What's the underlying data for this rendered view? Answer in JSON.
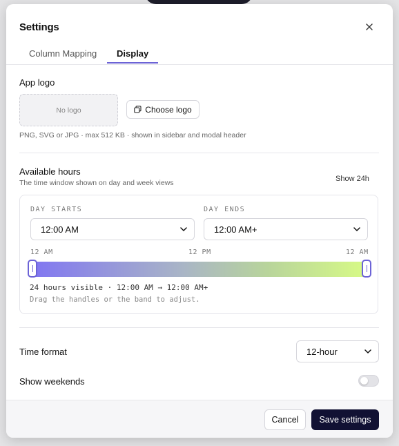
{
  "dialog": {
    "title": "Settings",
    "tabs": [
      {
        "label": "Column Mapping",
        "active": false
      },
      {
        "label": "Display",
        "active": true
      }
    ]
  },
  "logo": {
    "label": "App logo",
    "placeholder": "No logo",
    "choose_button": "Choose logo",
    "hint": "PNG, SVG or JPG · max 512 KB · shown in sidebar and modal header"
  },
  "hours": {
    "label": "Available hours",
    "description": "The time window shown on day and week views",
    "show24_label": "Show 24h",
    "day_starts_label": "DAY STARTS",
    "day_starts_value": "12:00 AM",
    "day_ends_label": "DAY ENDS",
    "day_ends_value": "12:00 AM+",
    "ticks": [
      "12 AM",
      "12 PM",
      "12 AM"
    ],
    "range_start_fraction": 0,
    "range_end_fraction": 1,
    "visible_summary": "24 hours visible · 12:00 AM → 12:00 AM+",
    "drag_hint": "Drag the handles or the band to adjust."
  },
  "time_format": {
    "label": "Time format",
    "value": "12-hour"
  },
  "weekends": {
    "label": "Show weekends",
    "enabled": false
  },
  "footer": {
    "cancel_label": "Cancel",
    "save_label": "Save settings"
  },
  "colors": {
    "accent": "#6c63d6",
    "primary_button": "#111133",
    "band_start": "#8075f2",
    "band_end": "#d8fb86"
  }
}
